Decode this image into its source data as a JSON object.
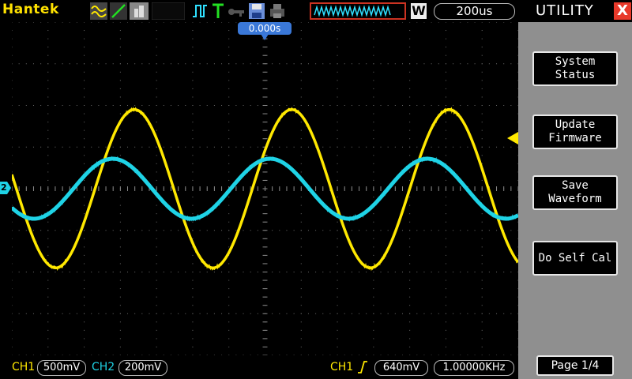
{
  "header": {
    "brand": "Hantek",
    "timebase": "200us",
    "mode_badge": "W",
    "icons": [
      "acquire-mode-icon",
      "display-mode-icon",
      "persistence-icon",
      "trigger-edge-icon",
      "trigger-t-icon",
      "key-icon",
      "save-icon",
      "print-icon",
      "memory-depth-waveform-icon"
    ]
  },
  "trigger_position": "0.000s",
  "markers": {
    "ch2_marker": "2"
  },
  "footer": {
    "ch1_label": "CH1",
    "ch1_scale": "500mV",
    "ch2_label": "CH2",
    "ch2_scale": "200mV",
    "trigger_source": "CH1",
    "trigger_level": "640mV",
    "frequency": "1.00000KHz"
  },
  "menu": {
    "title": "UTILITY",
    "close": "X",
    "buttons": [
      {
        "line1": "System",
        "line2": "Status"
      },
      {
        "line1": "Update",
        "line2": "Firmware"
      },
      {
        "line1": "Save",
        "line2": "Waveform"
      },
      {
        "line1": "Do Self Cal",
        "line2": ""
      }
    ],
    "page": "Page 1/4"
  },
  "colors": {
    "ch1": "#ffe800",
    "ch2": "#1fd3e6",
    "trigger_marker": "#3a78d8",
    "panel": "#8f8f8f"
  },
  "chart_data": {
    "type": "line",
    "title": "",
    "xlabel": "",
    "ylabel": "",
    "x_unit": "divisions (200us/div)",
    "xlim": [
      -7,
      7
    ],
    "ylim": [
      -4,
      4
    ],
    "grid": true,
    "series": [
      {
        "name": "CH1",
        "amplitude_div": 1.9,
        "offset_div": 0.0,
        "period_div": 4.35,
        "phase_div": -0.35
      },
      {
        "name": "CH2",
        "amplitude_div": 0.72,
        "offset_div": 0.0,
        "period_div": 4.35,
        "phase_div": -0.95
      }
    ]
  }
}
